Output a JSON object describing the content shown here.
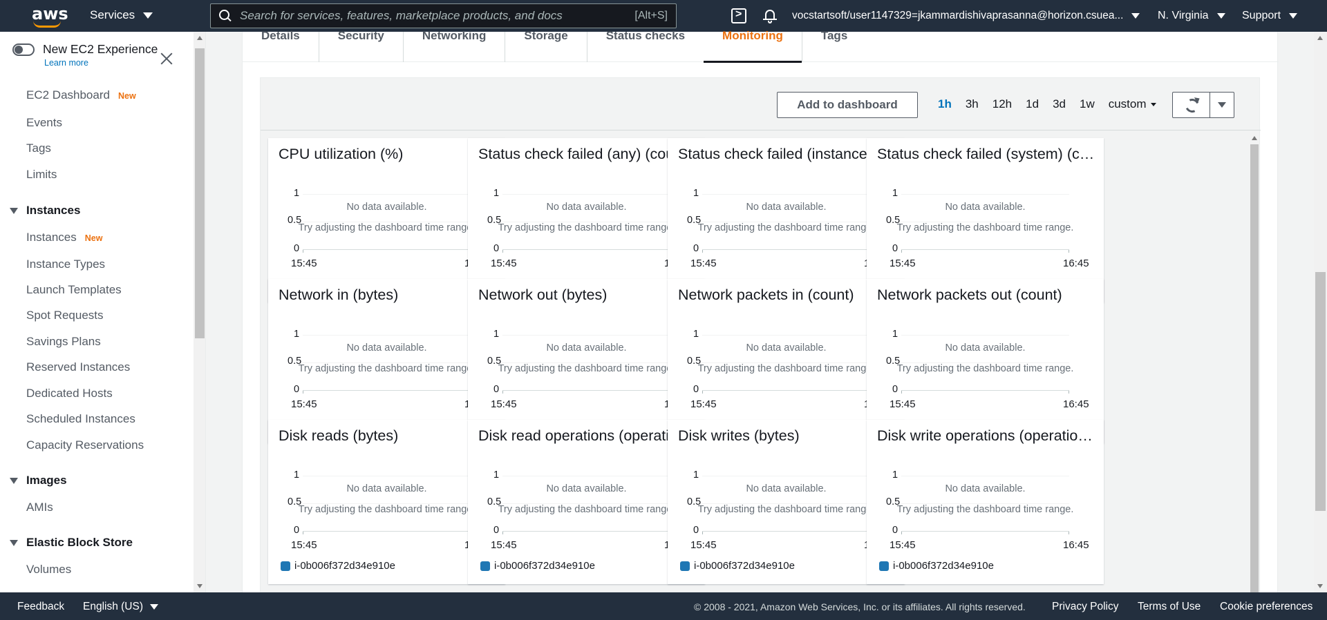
{
  "topnav": {
    "logo": "aws",
    "services": "Services",
    "search_placeholder": "Search for services, features, marketplace products, and docs",
    "search_shortcut": "[Alt+S]",
    "account": "vocstartsoft/user1147329=jkammardishivaprasanna@horizon.csuea...",
    "region": "N. Virginia",
    "support": "Support"
  },
  "sidebar": {
    "experience_title": "New EC2 Experience",
    "learn_more": "Learn more",
    "new_badge": "New",
    "items": [
      {
        "label": "EC2 Dashboard",
        "new": true
      },
      {
        "label": "Events"
      },
      {
        "label": "Tags"
      },
      {
        "label": "Limits"
      }
    ],
    "groups": [
      {
        "label": "Instances",
        "items": [
          "Instances",
          "Instance Types",
          "Launch Templates",
          "Spot Requests",
          "Savings Plans",
          "Reserved Instances",
          "Dedicated Hosts",
          "Scheduled Instances",
          "Capacity Reservations"
        ]
      },
      {
        "label": "Images",
        "items": [
          "AMIs"
        ]
      },
      {
        "label": "Elastic Block Store",
        "items": [
          "Volumes"
        ]
      }
    ]
  },
  "tabs": [
    "Details",
    "Security",
    "Networking",
    "Storage",
    "Status checks",
    "Monitoring",
    "Tags"
  ],
  "active_tab": "Monitoring",
  "toolbar": {
    "add_to_dashboard": "Add to dashboard",
    "ranges": [
      "1h",
      "3h",
      "12h",
      "1d",
      "3d",
      "1w"
    ],
    "active_range": "1h",
    "custom": "custom"
  },
  "chart_common": {
    "no_data": "No data available.",
    "hint": "Try adjusting the dashboard time range.",
    "y_ticks": [
      "1",
      "0.5",
      "0"
    ],
    "x_start": "15:45",
    "x_end": "16:45",
    "legend": "i-0b006f372d34e910e",
    "series_color": "#1f77b4"
  },
  "charts": [
    "CPU utilization (%)",
    "Status check failed (any) (count)",
    "Status check failed (instance) (count)",
    "Status check failed (system) (count)",
    "Network in (bytes)",
    "Network out (bytes)",
    "Network packets in (count)",
    "Network packets out (count)",
    "Disk reads (bytes)",
    "Disk read operations (operations)",
    "Disk writes (bytes)",
    "Disk write operations (operations)"
  ],
  "chart_data": {
    "type": "line",
    "x": [
      "15:45",
      "16:45"
    ],
    "series": [
      {
        "name": "i-0b006f372d34e910e",
        "values": []
      }
    ],
    "ylim": [
      0,
      1
    ]
  },
  "footer": {
    "feedback": "Feedback",
    "language": "English (US)",
    "copyright": "© 2008 - 2021, Amazon Web Services, Inc. or its affiliates. All rights reserved.",
    "privacy": "Privacy Policy",
    "terms": "Terms of Use",
    "cookies": "Cookie preferences"
  }
}
